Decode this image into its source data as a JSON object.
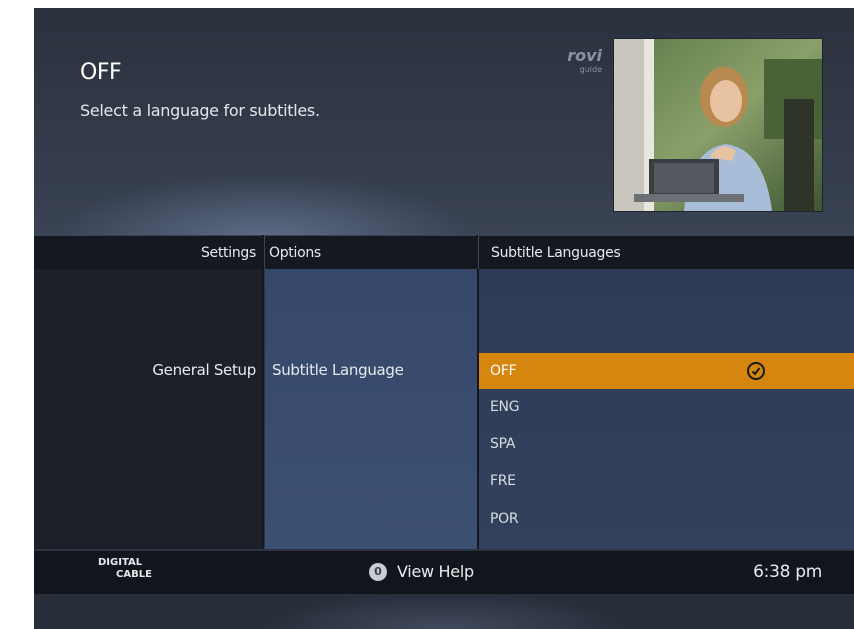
{
  "header": {
    "title": "OFF",
    "subtitle": "Select a language for subtitles.",
    "brand_line1": "rovi",
    "brand_line2": "guide",
    "thumbnail_icon": "video-preview-thumbnail"
  },
  "columns": {
    "settings_header": "Settings",
    "options_header": "Options",
    "languages_header": "Subtitle Languages"
  },
  "settings": {
    "selected": "General Setup"
  },
  "options": {
    "selected": "Subtitle Language"
  },
  "languages": [
    {
      "label": "OFF",
      "selected": true
    },
    {
      "label": "ENG",
      "selected": false
    },
    {
      "label": "SPA",
      "selected": false
    },
    {
      "label": "FRE",
      "selected": false
    },
    {
      "label": "POR",
      "selected": false
    }
  ],
  "footer": {
    "logo_line1": "DIGITAL",
    "logo_line2": "CABLE",
    "help_key": "0",
    "help_label": "View Help",
    "time": "6:38 pm"
  },
  "colors": {
    "highlight": "#d4860e",
    "background": "#2c3342",
    "options_panel": "#3a4d70"
  }
}
